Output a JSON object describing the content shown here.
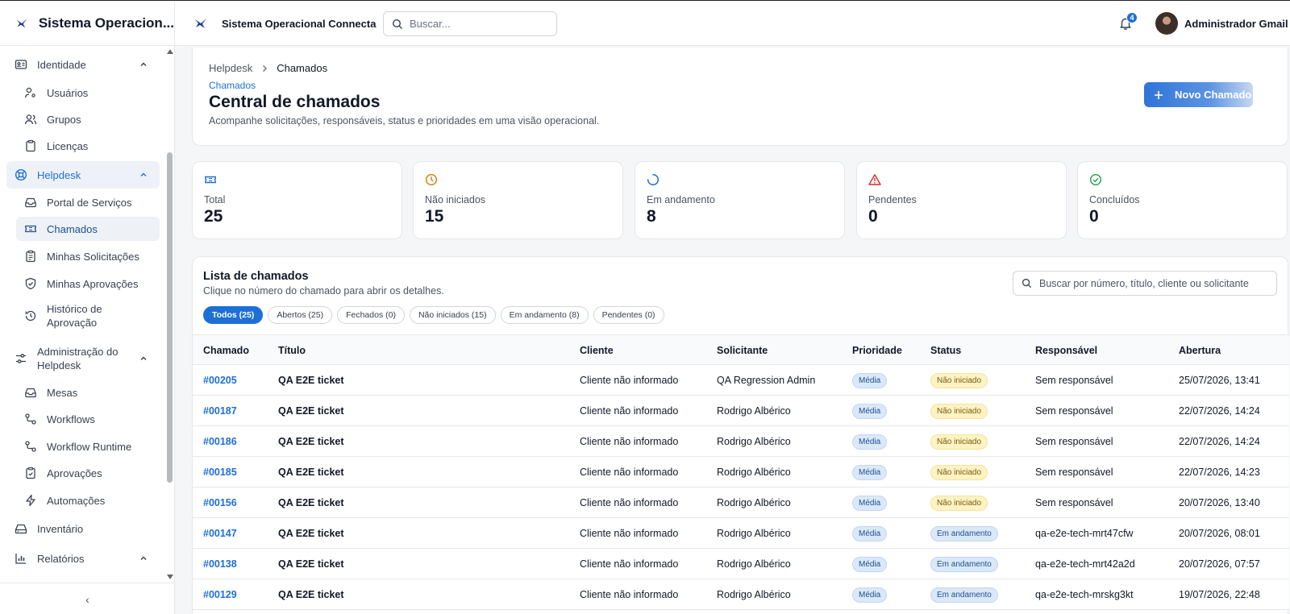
{
  "sidebar": {
    "app_title": "Sistema Operacion...",
    "items": [
      {
        "label": "Identidade",
        "icon": "id-card-icon"
      },
      {
        "label": "Usuários",
        "icon": "user-key-icon"
      },
      {
        "label": "Grupos",
        "icon": "users-icon"
      },
      {
        "label": "Licenças",
        "icon": "clipboard-icon"
      },
      {
        "label": "Helpdesk",
        "icon": "lifebuoy-icon"
      },
      {
        "label": "Portal de Serviços",
        "icon": "inbox-icon"
      },
      {
        "label": "Chamados",
        "icon": "ticket-icon"
      },
      {
        "label": "Minhas Solicitações",
        "icon": "clipboard-list-icon"
      },
      {
        "label": "Minhas Aprovações",
        "icon": "shield-check-icon"
      },
      {
        "label": "Histórico de Aprovação",
        "icon": "history-icon"
      },
      {
        "label": "Administração do Helpdesk",
        "icon": "sliders-icon"
      },
      {
        "label": "Mesas",
        "icon": "inbox-icon"
      },
      {
        "label": "Workflows",
        "icon": "workflow-icon"
      },
      {
        "label": "Workflow Runtime",
        "icon": "workflow-icon"
      },
      {
        "label": "Aprovações",
        "icon": "clipboard-check-icon"
      },
      {
        "label": "Automações",
        "icon": "zap-icon"
      },
      {
        "label": "Inventário",
        "icon": "hard-drive-icon"
      },
      {
        "label": "Relatórios",
        "icon": "bar-chart-icon"
      }
    ],
    "collapse_glyph": "‹"
  },
  "topbar": {
    "title": "Sistema Operacional Connecta",
    "search_placeholder": "Buscar...",
    "notification_count": "4",
    "user_name": "Administrador Gmail"
  },
  "header": {
    "breadcrumb": [
      "Helpdesk",
      "Chamados"
    ],
    "eyebrow": "Chamados",
    "title": "Central de chamados",
    "subtitle": "Acompanhe solicitações, responsáveis, status e prioridades em uma visão operacional.",
    "new_button": "Novo Chamado"
  },
  "stats": [
    {
      "label": "Total",
      "value": "25",
      "icon": "ticket-icon",
      "color": "#1d6fd6"
    },
    {
      "label": "Não iniciados",
      "value": "15",
      "icon": "clock-icon",
      "color": "#d97706"
    },
    {
      "label": "Em andamento",
      "value": "8",
      "icon": "loader-icon",
      "color": "#1d6fd6"
    },
    {
      "label": "Pendentes",
      "value": "0",
      "icon": "alert-triangle-icon",
      "color": "#dc2626"
    },
    {
      "label": "Concluídos",
      "value": "0",
      "icon": "check-circle-icon",
      "color": "#16a34a"
    }
  ],
  "list": {
    "title": "Lista de chamados",
    "subtitle": "Clique no número do chamado para abrir os detalhes.",
    "search_placeholder": "Buscar por número, título, cliente ou solicitante",
    "filters": [
      "Todos (25)",
      "Abertos (25)",
      "Fechados (0)",
      "Não iniciados (15)",
      "Em andamento (8)",
      "Pendentes (0)"
    ],
    "columns": [
      "Chamado",
      "Título",
      "Cliente",
      "Solicitante",
      "Prioridade",
      "Status",
      "Responsável",
      "Abertura"
    ],
    "rows": [
      {
        "num": "#00205",
        "title": "QA E2E ticket",
        "client": "Cliente não informado",
        "requester": "QA Regression Admin",
        "priority": "Média",
        "status": "Não iniciado",
        "owner": "Sem responsável",
        "opened": "25/07/2026, 13:41"
      },
      {
        "num": "#00187",
        "title": "QA E2E ticket",
        "client": "Cliente não informado",
        "requester": "Rodrigo Albérico",
        "priority": "Média",
        "status": "Não iniciado",
        "owner": "Sem responsável",
        "opened": "22/07/2026, 14:24"
      },
      {
        "num": "#00186",
        "title": "QA E2E ticket",
        "client": "Cliente não informado",
        "requester": "Rodrigo Albérico",
        "priority": "Média",
        "status": "Não iniciado",
        "owner": "Sem responsável",
        "opened": "22/07/2026, 14:24"
      },
      {
        "num": "#00185",
        "title": "QA E2E ticket",
        "client": "Cliente não informado",
        "requester": "Rodrigo Albérico",
        "priority": "Média",
        "status": "Não iniciado",
        "owner": "Sem responsável",
        "opened": "22/07/2026, 14:23"
      },
      {
        "num": "#00156",
        "title": "QA E2E ticket",
        "client": "Cliente não informado",
        "requester": "Rodrigo Albérico",
        "priority": "Média",
        "status": "Não iniciado",
        "owner": "Sem responsável",
        "opened": "20/07/2026, 13:40"
      },
      {
        "num": "#00147",
        "title": "QA E2E ticket",
        "client": "Cliente não informado",
        "requester": "Rodrigo Albérico",
        "priority": "Média",
        "status": "Em andamento",
        "owner": "qa-e2e-tech-mrt47cfw",
        "opened": "20/07/2026, 08:01"
      },
      {
        "num": "#00138",
        "title": "QA E2E ticket",
        "client": "Cliente não informado",
        "requester": "Rodrigo Albérico",
        "priority": "Média",
        "status": "Em andamento",
        "owner": "qa-e2e-tech-mrt42a2d",
        "opened": "20/07/2026, 07:57"
      },
      {
        "num": "#00129",
        "title": "QA E2E ticket",
        "client": "Cliente não informado",
        "requester": "Rodrigo Albérico",
        "priority": "Média",
        "status": "Em andamento",
        "owner": "qa-e2e-tech-mrskg3kt",
        "opened": "19/07/2026, 22:48"
      }
    ]
  }
}
